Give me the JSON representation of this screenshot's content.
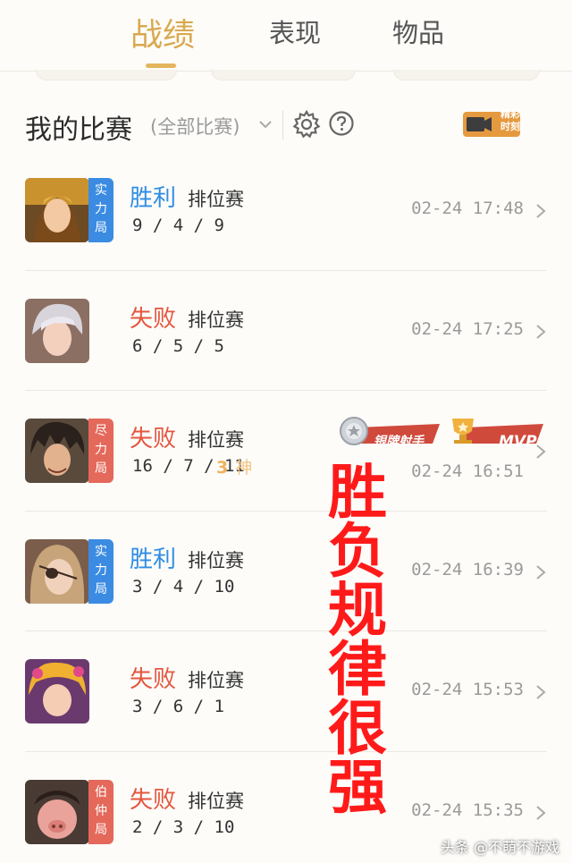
{
  "tabs": [
    {
      "label": "战绩",
      "active": true
    },
    {
      "label": "表现",
      "active": false
    },
    {
      "label": "物品",
      "active": false
    }
  ],
  "header": {
    "title": "我的比赛",
    "filter": "(全部比赛)",
    "highlight_label": "精彩时刻"
  },
  "matches": [
    {
      "badge": "实力局",
      "badge_color": "#3b8be2",
      "result": "胜利",
      "outcome": "win",
      "mode": "排位赛",
      "kda": "9 / 4 / 9",
      "time": "02-24 17:48",
      "avatar": "hero-1"
    },
    {
      "badge": "",
      "badge_color": "",
      "result": "失败",
      "outcome": "lose",
      "mode": "排位赛",
      "kda": "6 / 5 / 5",
      "time": "02-24 17:25",
      "avatar": "hero-2"
    },
    {
      "badge": "尽力局",
      "badge_color": "#e4695a",
      "result": "失败",
      "outcome": "lose",
      "mode": "排位赛",
      "kda": "16 / 7 / 11",
      "time": "02-24 16:51",
      "avatar": "hero-3",
      "streak": "3",
      "streak_label": "神",
      "medal_silver": "银牌射手",
      "medal_mvp": "MVP"
    },
    {
      "badge": "实力局",
      "badge_color": "#3b8be2",
      "result": "胜利",
      "outcome": "win",
      "mode": "排位赛",
      "kda": "3 / 4 / 10",
      "time": "02-24 16:39",
      "avatar": "hero-4"
    },
    {
      "badge": "",
      "badge_color": "",
      "result": "失败",
      "outcome": "lose",
      "mode": "排位赛",
      "kda": "3 / 6 / 1",
      "time": "02-24 15:53",
      "avatar": "hero-5"
    },
    {
      "badge": "伯仲局",
      "badge_color": "#e4695a",
      "result": "失败",
      "outcome": "lose",
      "mode": "排位赛",
      "kda": "2 / 3 / 10",
      "time": "02-24 15:35",
      "avatar": "hero-6"
    }
  ],
  "overlay_text": "胜负规律很强",
  "watermark": "头条 @不萌不游戏",
  "colors": {
    "accent": "#d9a94e",
    "win": "#2f8de4",
    "lose": "#e4573f",
    "overlay": "#ff1a1a"
  }
}
